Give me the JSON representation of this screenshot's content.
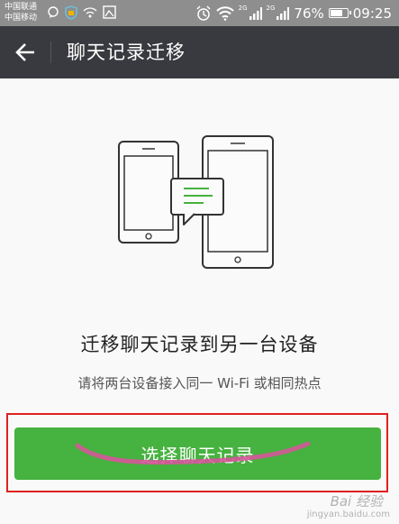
{
  "status_bar": {
    "carrier1": "中国联通",
    "carrier2": "中国移动",
    "network1": "2G",
    "network2": "2G",
    "battery_percent": "76%",
    "battery_level": 0.76,
    "time": "09:25",
    "icons": [
      "chat-bubble-icon",
      "shield-icon",
      "wifi-off-icon",
      "image-icon",
      "alarm-icon",
      "wifi-icon",
      "signal-icon",
      "signal-icon",
      "battery-icon"
    ]
  },
  "app_bar": {
    "back_icon": "arrow-left-icon",
    "title": "聊天记录迁移"
  },
  "main": {
    "illustration_icon": "phone-transfer-icon",
    "heading": "迁移聊天记录到另一台设备",
    "subtitle": "请将两台设备接入同一 Wi-Fi 或相同热点",
    "primary_button_label": "选择聊天记录"
  },
  "watermark": {
    "text": "Bai 经验",
    "url_text": "jingyan.baidu.com"
  },
  "colors": {
    "status_bar_bg": "#8e8e8e",
    "app_bar_bg": "#393a3f",
    "accent_green": "#46b23f",
    "annotation_red": "#e02020",
    "annotation_pink": "#d6559a"
  }
}
